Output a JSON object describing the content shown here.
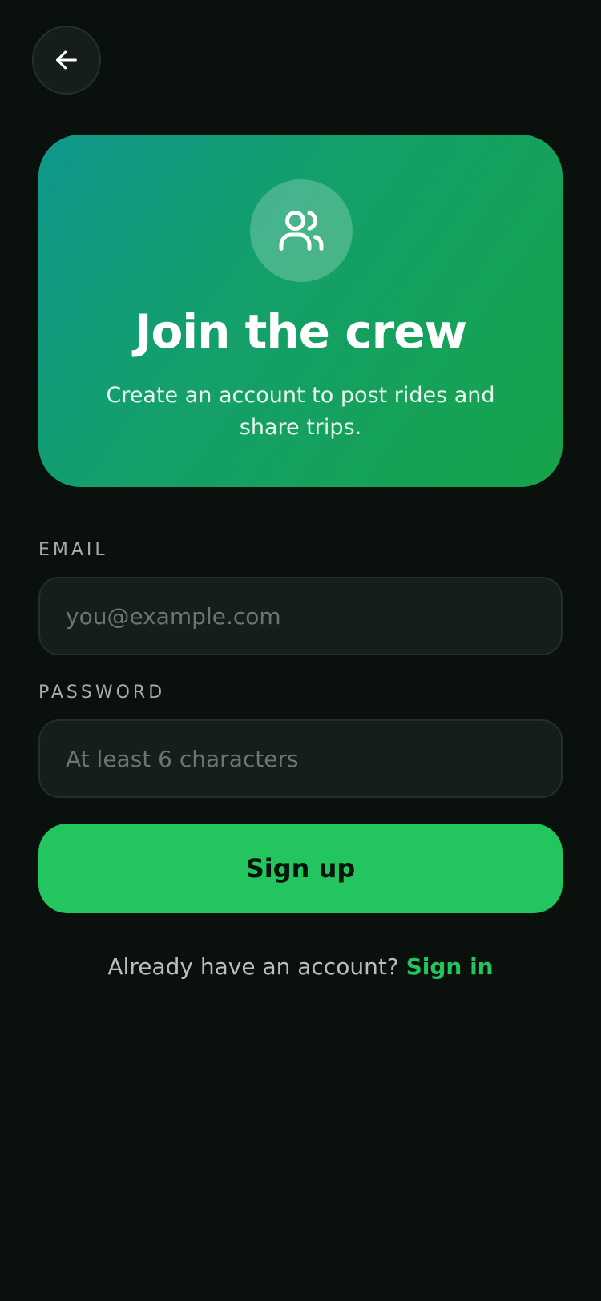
{
  "colors": {
    "background": "#0a100c",
    "accent": "#22c55e",
    "hero_gradient_start": "#10978c",
    "hero_gradient_end": "#16a34a",
    "input_background": "#141f1a"
  },
  "header": {
    "back_icon": "arrow-left-icon"
  },
  "hero": {
    "icon": "users-icon",
    "title": "Join the crew",
    "subtitle": "Create an account to post rides and share trips."
  },
  "form": {
    "email": {
      "label": "EMAIL",
      "value": "",
      "placeholder": "you@example.com"
    },
    "password": {
      "label": "PASSWORD",
      "value": "",
      "placeholder": "At least 6 characters"
    },
    "submit_label": "Sign up"
  },
  "footer": {
    "prompt": "Already have an account?",
    "link_label": "Sign in"
  }
}
